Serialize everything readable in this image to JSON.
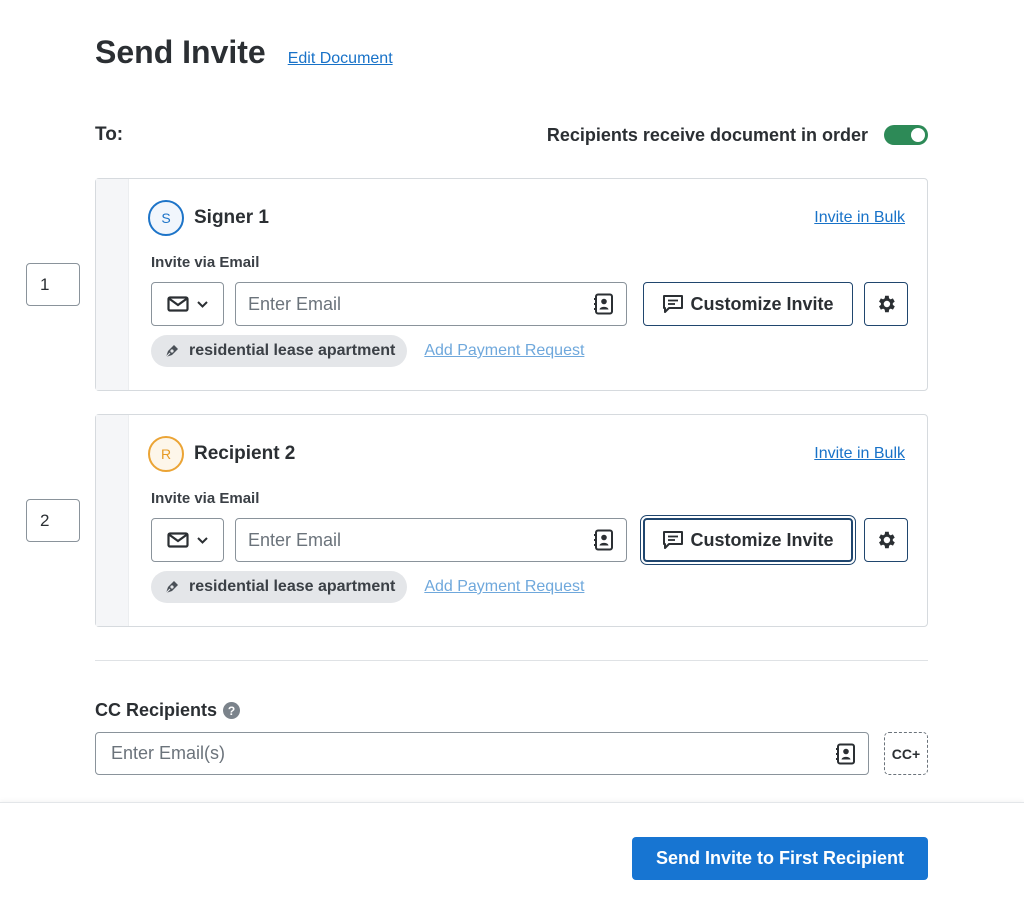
{
  "header": {
    "title": "Send Invite",
    "edit_link": "Edit Document"
  },
  "recipients_section": {
    "to_label": "To:",
    "order_label": "Recipients receive document in order",
    "order_enabled": true,
    "toggle_color": "#2d8a57"
  },
  "recipients": [
    {
      "order": "1",
      "avatar_letter": "S",
      "avatar_color": "#1d74c8",
      "name": "Signer 1",
      "bulk_link": "Invite in Bulk",
      "via_label": "Invite via Email",
      "method_icon": "envelope-icon",
      "email_placeholder": "Enter Email",
      "email_value": "",
      "customize_label": "Customize Invite",
      "document_chip": "residential lease apartment",
      "payment_link": "Add Payment Request"
    },
    {
      "order": "2",
      "avatar_letter": "R",
      "avatar_color": "#eba435",
      "name": "Recipient 2",
      "bulk_link": "Invite in Bulk",
      "via_label": "Invite via Email",
      "method_icon": "envelope-icon",
      "email_placeholder": "Enter Email",
      "email_value": "",
      "customize_label": "Customize Invite",
      "document_chip": "residential lease apartment",
      "payment_link": "Add Payment Request"
    }
  ],
  "cc": {
    "label": "CC Recipients",
    "help_icon": "?",
    "placeholder": "Enter Email(s)",
    "add_label": "CC+"
  },
  "footer": {
    "send_label": "Send Invite to First Recipient",
    "send_color": "#1775d2"
  }
}
